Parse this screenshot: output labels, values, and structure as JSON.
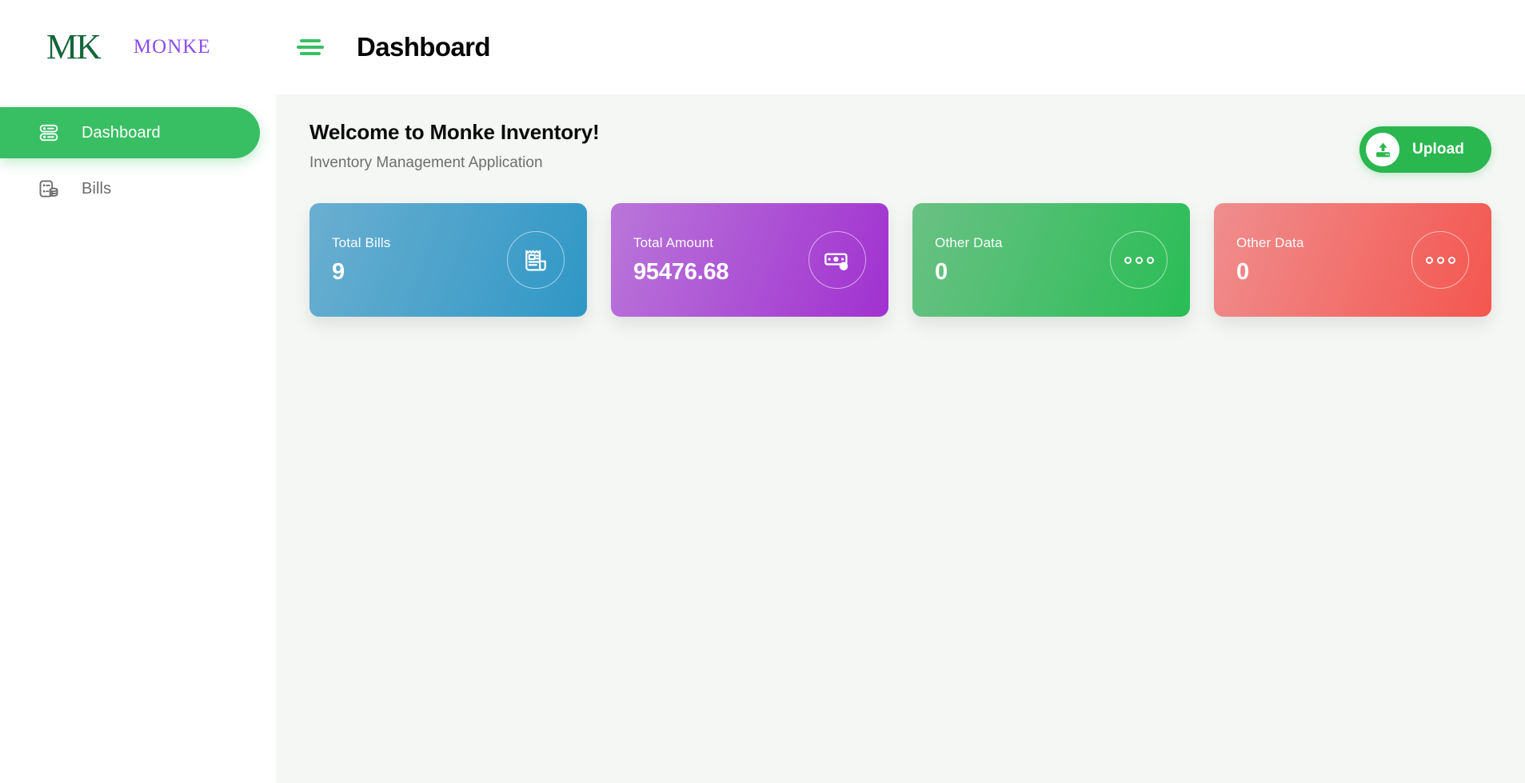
{
  "brand": {
    "mark": "MK",
    "name": "MONKE",
    "mark_color": "#14663a",
    "name_color": "#8a4bef"
  },
  "header": {
    "menu_icon": "hamburger-icon",
    "title": "Dashboard",
    "accent_color": "#39bf63"
  },
  "sidebar": {
    "items": [
      {
        "label": "Dashboard",
        "icon": "server-list-icon",
        "active": true
      },
      {
        "label": "Bills",
        "icon": "bills-database-icon",
        "active": false
      }
    ],
    "active_bg": "#39bf63"
  },
  "main": {
    "welcome_title": "Welcome to Monke Inventory!",
    "welcome_subtitle": "Inventory Management Application",
    "upload": {
      "label": "Upload",
      "icon": "upload-icon",
      "color": "#2ab74f"
    },
    "cards": [
      {
        "label": "Total Bills",
        "value": "9",
        "icon": "receipt-icon",
        "color_from": "#6aafd0",
        "color_to": "#2f97c6"
      },
      {
        "label": "Total Amount",
        "value": "95476.68",
        "icon": "money-icon",
        "color_from": "#b976d9",
        "color_to": "#a131d0"
      },
      {
        "label": "Other Data",
        "value": "0",
        "icon": "ellipsis-icon",
        "color_from": "#6ac184",
        "color_to": "#29bd55"
      },
      {
        "label": "Other Data",
        "value": "0",
        "icon": "ellipsis-icon",
        "color_from": "#ef8e8e",
        "color_to": "#f4564f"
      }
    ]
  }
}
